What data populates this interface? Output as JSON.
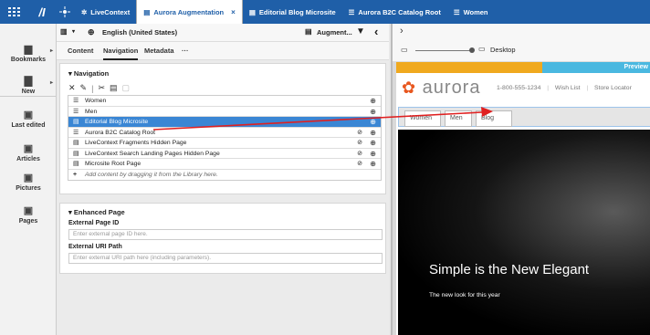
{
  "topbar": {
    "tabs": [
      {
        "label": "LiveContext"
      },
      {
        "label": "Aurora Augmentation"
      },
      {
        "label": "Editorial Blog Microsite"
      },
      {
        "label": "Aurora B2C Catalog Root"
      },
      {
        "label": "Women"
      }
    ],
    "close_icon": "×"
  },
  "sidebar": {
    "items": [
      {
        "label": "Bookmarks",
        "icon": "bookmark-folder-icon"
      },
      {
        "label": "New",
        "icon": "new-document-icon"
      },
      {
        "label": "Last edited",
        "icon": "last-edited-icon"
      },
      {
        "label": "Articles",
        "icon": "articles-icon"
      },
      {
        "label": "Pictures",
        "icon": "pictures-icon"
      },
      {
        "label": "Pages",
        "icon": "pages-icon"
      }
    ]
  },
  "editor": {
    "locale": "English (United States)",
    "doc_type": "Augment...",
    "tabs": [
      {
        "label": "Content"
      },
      {
        "label": "Navigation"
      },
      {
        "label": "Metadata"
      },
      {
        "label": "···"
      }
    ],
    "navigation": {
      "title": "Navigation",
      "items": [
        {
          "label": "Women",
          "icon": "category-icon",
          "hidden": false,
          "selected": false
        },
        {
          "label": "Men",
          "icon": "category-icon",
          "hidden": false,
          "selected": false
        },
        {
          "label": "Editorial Blog Microsite",
          "icon": "page-icon",
          "hidden": false,
          "selected": true
        },
        {
          "label": "Aurora B2C Catalog Root",
          "icon": "category-icon",
          "hidden": true,
          "selected": false
        },
        {
          "label": "LiveContext Fragments Hidden Page",
          "icon": "page-icon",
          "hidden": true,
          "selected": false
        },
        {
          "label": "LiveContext Search Landing Pages Hidden Page",
          "icon": "page-icon",
          "hidden": true,
          "selected": false
        },
        {
          "label": "Microsite Root Page",
          "icon": "page-icon",
          "hidden": true,
          "selected": false
        }
      ],
      "add_hint": "Add content by dragging it from the Library here."
    },
    "enhanced_page": {
      "title": "Enhanced Page",
      "external_page_id_label": "External Page ID",
      "external_page_id_placeholder": "Enter external page ID here.",
      "external_uri_label": "External URI Path",
      "external_uri_placeholder": "Enter external URI path here (including parameters)."
    }
  },
  "preview": {
    "device": "Desktop",
    "preview_label": "Preview",
    "logo_text": "aurora",
    "phone": "1-800-555-1234",
    "links": [
      "Wish List",
      "Store Locator"
    ],
    "site_nav": [
      "Women",
      "Men",
      "Blog"
    ],
    "hero_title": "Simple is the New Elegant",
    "hero_subtitle": "The new look for this year"
  },
  "colors": {
    "topbar": "#1f5fa8",
    "selected_row": "#3a86d4",
    "arrow": "#e02020",
    "aurora_orange": "#f0a91e",
    "aurora_blue": "#4ab8e0"
  }
}
